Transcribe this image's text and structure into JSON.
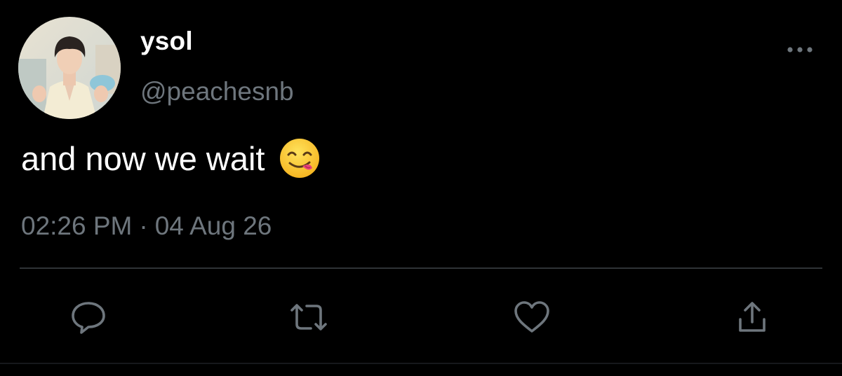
{
  "tweet": {
    "display_name": "ysol",
    "handle": "@peachesnb",
    "text": "and now we wait",
    "emoji": "face-savoring-food-emoji",
    "time": "02:26 PM",
    "separator": "·",
    "date": "04 Aug 26"
  },
  "icons": {
    "more": "more-options-icon",
    "reply": "reply-icon",
    "retweet": "retweet-icon",
    "like": "like-heart-icon",
    "share": "share-icon"
  },
  "colors": {
    "background": "#000000",
    "primary_text": "#ffffff",
    "secondary_text": "#6e767d",
    "divider": "#2f3336",
    "icon": "#6e767d"
  }
}
